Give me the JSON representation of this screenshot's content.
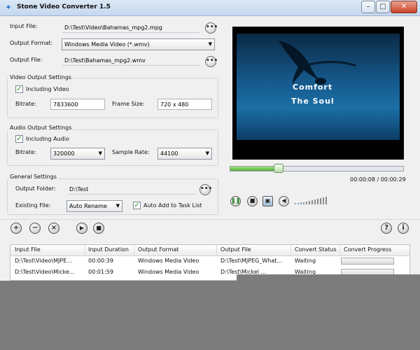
{
  "window": {
    "title": "Stone Video Converter 1.5",
    "minimize": "–",
    "maximize": "□",
    "close": "✕"
  },
  "top": {
    "input_file_label": "Input File:",
    "input_file_value": "D:\\Test\\Video\\Bahamas_mpg2.mpg",
    "output_format_label": "Output Format:",
    "output_format_value": "Windows Media Video (*.wmv)",
    "output_file_label": "Output File:",
    "output_file_value": "D:\\Test\\Bahamas_mpg2.wmv",
    "browse": "•••"
  },
  "video_settings": {
    "title": "Video Output Settings",
    "including_label": "Including Video",
    "bitrate_label": "Bitrate:",
    "bitrate_value": "7833600",
    "frame_size_label": "Frame Size:",
    "frame_size_value": "720 x 480"
  },
  "audio_settings": {
    "title": "Audio Output Settings",
    "including_label": "Including Audio",
    "bitrate_label": "Bitrate:",
    "bitrate_value": "320000",
    "sample_rate_label": "Sample Rate:",
    "sample_rate_value": "44100"
  },
  "general_settings": {
    "title": "General Settings",
    "output_folder_label": "Output Folder:",
    "output_folder_value": "D:\\Test",
    "existing_file_label": "Existing File:",
    "existing_file_value": "Auto Rename",
    "auto_add_label": "Auto Add to Task List"
  },
  "player": {
    "caption_line1": "Comfort",
    "caption_line2": "The Soul",
    "time": "00:00:08 / 00:00:29",
    "progress_fraction": 0.28
  },
  "toolbar": {
    "add": "+",
    "remove": "−",
    "clear": "×",
    "start": "▶",
    "stop": "■",
    "help": "?",
    "info": "i"
  },
  "list": {
    "columns": [
      "Input File",
      "Input Duration",
      "Output Format",
      "Output File",
      "Convert Status",
      "Convert Progress"
    ],
    "rows": [
      {
        "input": "D:\\Test\\Video\\MJPE...",
        "duration": "00:00:39",
        "format": "Windows Media Video",
        "output": "D:\\Test\\MJPEG_What...",
        "status": "Waiting"
      },
      {
        "input": "D:\\Test\\Video\\Micke...",
        "duration": "00:01:59",
        "format": "Windows Media Video",
        "output": "D:\\Test\\Mickel ...",
        "status": "Waiting"
      }
    ]
  },
  "colors": {
    "accent_green": "#4fae2e",
    "title_blue": "#c4d8ee"
  }
}
